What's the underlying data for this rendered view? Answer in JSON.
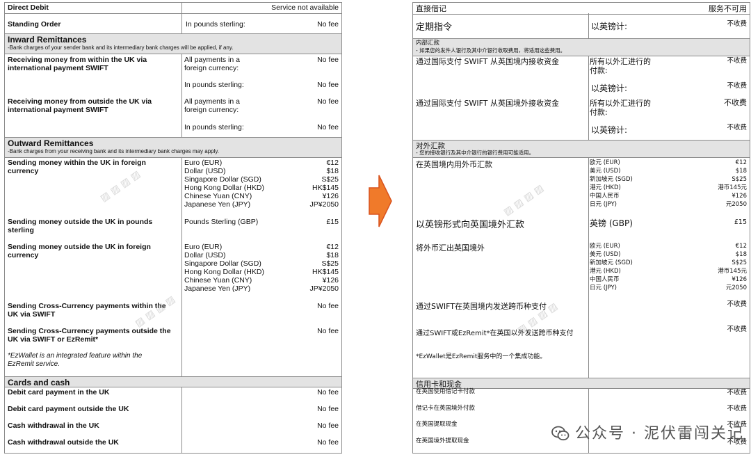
{
  "left": {
    "direct_debit": {
      "label": "Direct Debit",
      "value": "Service not available"
    },
    "standing_order": {
      "label": "Standing Order",
      "sub": "In pounds sterling:",
      "fee": "No fee"
    },
    "inward": {
      "title": "Inward Remittances",
      "note": "-Bank charges of your sender bank and its intermediary bank charges will be applied, if any.",
      "within": {
        "label": "Receiving money from within the UK via international payment SWIFT",
        "r1": "All payments in a foreign currency:",
        "f1": "No fee",
        "r2": "In pounds sterling:",
        "f2": "No fee"
      },
      "outside": {
        "label": "Receiving money from outside the UK via international payment SWIFT",
        "r1": "All payments in a foreign currency:",
        "f1": "No fee",
        "r2": "In pounds sterling:",
        "f2": "No fee"
      }
    },
    "outward": {
      "title": "Outward Remittances",
      "note": "-Bank charges from your receiving bank and its intermediary bank charges may apply.",
      "within_foreign": {
        "label": "Sending money within the UK in foreign currency",
        "currencies": [
          "Euro (EUR)",
          "Dollar (USD)",
          "Singapore Dollar (SGD)",
          "Hong Kong Dollar (HKD)",
          "Chinese Yuan (CNY)",
          "Japanese Yen (JPY)"
        ],
        "amounts": [
          "€12",
          "$18",
          "S$25",
          "HK$145",
          "¥126",
          "JP¥2050"
        ]
      },
      "outside_gbp": {
        "label": "Sending money outside the UK in pounds sterling",
        "currency": "Pounds Sterling (GBP)",
        "amount": "£15"
      },
      "outside_foreign": {
        "label": "Sending money outside the UK in foreign currency",
        "currencies": [
          "Euro (EUR)",
          "Dollar (USD)",
          "Singapore Dollar (SGD)",
          "Hong Kong Dollar (HKD)",
          "Chinese Yuan (CNY)",
          "Japanese Yen (JPY)"
        ],
        "amounts": [
          "€12",
          "$18",
          "S$25",
          "HK$145",
          "¥126",
          "JP¥2050"
        ]
      },
      "cross_within": {
        "label": "Sending Cross-Currency payments within the UK via SWIFT",
        "fee": "No fee"
      },
      "cross_outside": {
        "label": "Sending Cross-Currency payments outside the UK via SWIFT or EzRemit*",
        "fee": "No fee"
      },
      "footnote": "*EzWallet is an integrated feature within the EzRemit service."
    },
    "cards": {
      "title": "Cards and cash",
      "rows": [
        {
          "label": "Debit card payment in the UK",
          "fee": "No fee"
        },
        {
          "label": "Debit card payment outside the UK",
          "fee": "No fee"
        },
        {
          "label": "Cash withdrawal in the UK",
          "fee": "No fee"
        },
        {
          "label": "Cash withdrawal outside the UK",
          "fee": "No fee"
        }
      ]
    }
  },
  "right": {
    "direct_debit": {
      "label": "直接借记",
      "value": "服务不可用"
    },
    "standing_order": {
      "label": "定期指令",
      "sub": "以英镑计:",
      "fee": "不收费"
    },
    "inward": {
      "title": "内部汇款",
      "note": "- 如果您的发件人银行及其中介银行收取费用，将适用这些费用。",
      "within": {
        "label": "通过国际支付 SWIFT 从英国境内接收资金",
        "r1": "所有以外汇进行的付款:",
        "f1": "不收费",
        "r2": "以英镑计:",
        "f2": "不收费"
      },
      "outside": {
        "label": "通过国际支付 SWIFT 从英国境外接收资金",
        "r1": "所有以外汇进行的付款:",
        "f1": "不收费",
        "r2": "以英镑计:",
        "f2": "不收费"
      }
    },
    "outward": {
      "title": "对外汇款",
      "note": "- 您的接收银行及其中介银行的银行费用可能适用。",
      "within_foreign": {
        "label": "在英国境内用外币汇款",
        "currencies": [
          "欧元 (EUR)",
          "美元 (USD)",
          "新加坡元 (SGD)",
          "港元 (HKD)",
          "中国人民币",
          "日元 (JPY)"
        ],
        "amounts": [
          "€12",
          "$18",
          "S$25",
          "港币145元",
          "¥126",
          "元2050"
        ]
      },
      "outside_gbp": {
        "label": "以英镑形式向英国境外汇款",
        "currency": "英镑 (GBP)",
        "amount": "£15"
      },
      "outside_foreign": {
        "label": "将外币汇出英国境外",
        "currencies": [
          "欧元 (EUR)",
          "美元 (USD)",
          "新加坡元 (SGD)",
          "港元 (HKD)",
          "中国人民币",
          "日元 (JPY)"
        ],
        "amounts": [
          "€12",
          "$18",
          "S$25",
          "港币145元",
          "¥126",
          "元2050"
        ]
      },
      "cross_within": {
        "label": "通过SWIFT在英国境内发送跨币种支付",
        "fee": "不收费"
      },
      "cross_outside": {
        "label": "通过SWIFT或EzRemit*在英国以外发送跨币种支付",
        "fee": "不收费"
      },
      "footnote": "*EzWallet是EzRemit服务中的一个集成功能。"
    },
    "cards": {
      "title": "信用卡和现金",
      "rows": [
        {
          "label": "在英国使用借记卡付款",
          "fee": "不收费"
        },
        {
          "label": "借记卡在英国境外付款",
          "fee": "不收费"
        },
        {
          "label": "在英国提取现金",
          "fee": "不收费"
        },
        {
          "label": "在英国境外提取现金",
          "fee": "不收费"
        }
      ]
    }
  },
  "watermark": {
    "text": "公众号 · 泥伏雷闯关记",
    "icon": "wechat-icon"
  },
  "arrow_color": "#f07a2a"
}
